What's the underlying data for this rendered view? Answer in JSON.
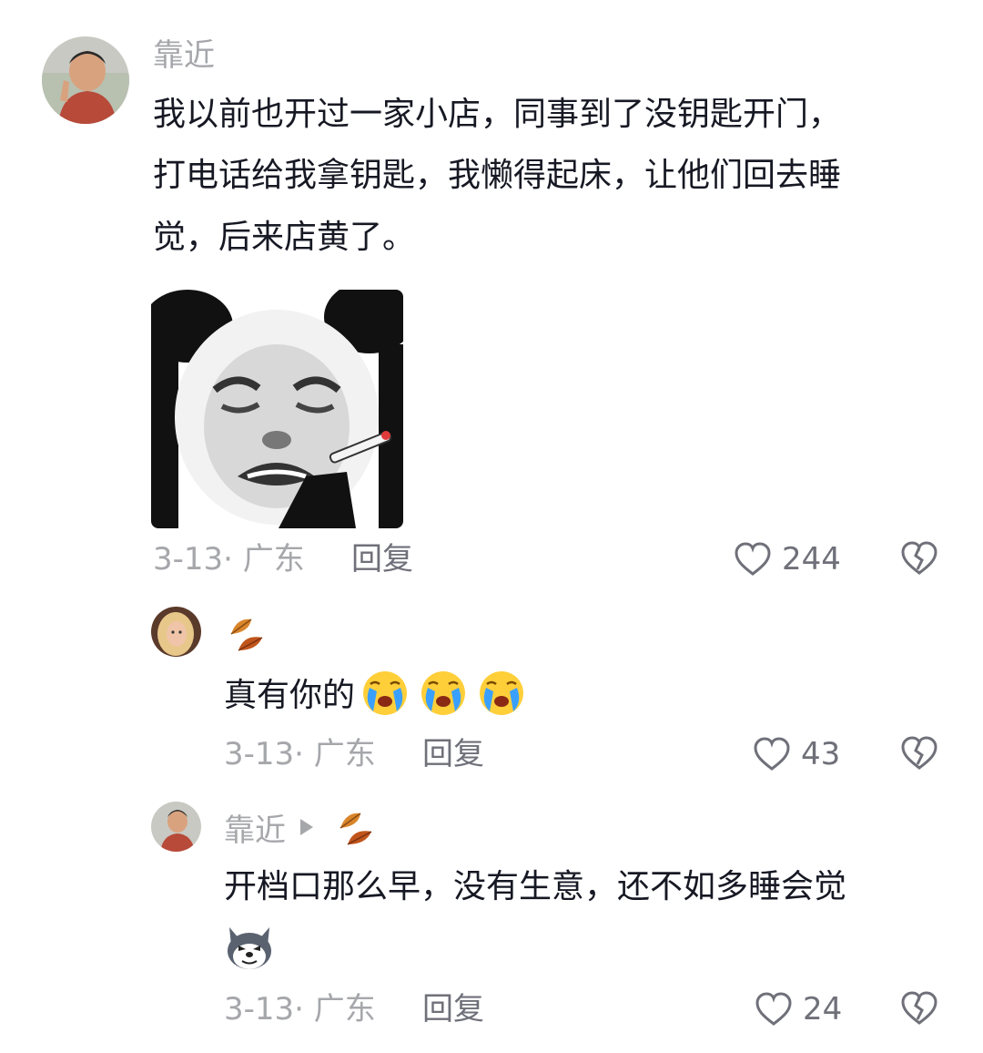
{
  "comment_main": {
    "username": "靠近",
    "text_lines": [
      "我以前也开过一家小店，同事到了没钥匙开门，",
      "打电话给我拿钥匙，我懒得起床，让他们回去睡",
      "觉，后来店黄了。"
    ],
    "sticker_icon": "crying-panda-smoking-sticker",
    "date_location": "3-13· 广东",
    "reply_label": "回复",
    "like_count": "244",
    "like_icon": "heart-outline-icon",
    "dislike_icon": "broken-heart-icon"
  },
  "reply_1": {
    "username_icon": "fallen-leaves-emoji",
    "text": "真有你的",
    "emoji_icons": [
      "crying-face-emoji",
      "crying-face-emoji",
      "crying-face-emoji"
    ],
    "date_location": "3-13· 广东",
    "reply_label": "回复",
    "like_count": "43"
  },
  "reply_2": {
    "username": "靠近",
    "reply_to_icon": "fallen-leaves-emoji",
    "text": "开档口那么早，没有生意，还不如多睡会觉",
    "emoji_icon": "husky-dog-emoji",
    "date_location": "3-13· 广东",
    "reply_label": "回复",
    "like_count": "24"
  },
  "colors": {
    "text": "#161823",
    "secondary": "#a6a7ab",
    "action": "#6f7079"
  }
}
